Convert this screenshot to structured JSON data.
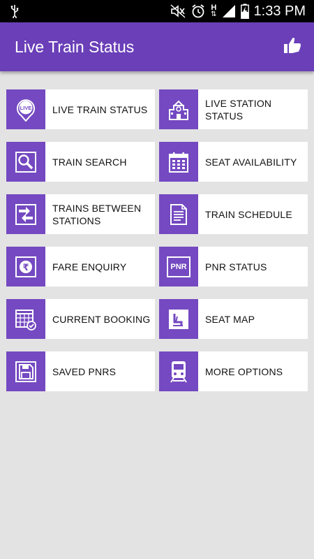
{
  "status_bar": {
    "time": "1:33 PM",
    "network_label": "H",
    "icons": [
      "usb-icon",
      "mute-icon",
      "alarm-icon",
      "network-data-icon",
      "signal-icon",
      "battery-charging-icon"
    ]
  },
  "app_bar": {
    "title": "Live Train Status",
    "action_icon": "thumbs-up-icon",
    "color": "#6a3fb8"
  },
  "menu": {
    "accent_color": "#7449c1",
    "items": [
      {
        "label": "LIVE TRAIN STATUS",
        "icon": "live-pin-icon"
      },
      {
        "label": "LIVE STATION STATUS",
        "icon": "station-building-icon"
      },
      {
        "label": "TRAIN SEARCH",
        "icon": "magnifier-icon"
      },
      {
        "label": "SEAT AVAILABILITY",
        "icon": "calendar-grid-icon"
      },
      {
        "label": "TRAINS BETWEEN STATIONS",
        "icon": "swap-arrows-icon"
      },
      {
        "label": "TRAIN SCHEDULE",
        "icon": "document-list-icon"
      },
      {
        "label": "FARE ENQUIRY",
        "icon": "rupee-coin-icon"
      },
      {
        "label": "PNR STATUS",
        "icon": "pnr-icon",
        "icon_text": "PNR"
      },
      {
        "label": "CURRENT BOOKING",
        "icon": "booking-calendar-icon"
      },
      {
        "label": "SEAT MAP",
        "icon": "seat-icon"
      },
      {
        "label": "SAVED PNRS",
        "icon": "floppy-disk-icon"
      },
      {
        "label": "MORE OPTIONS",
        "icon": "train-front-icon"
      }
    ]
  }
}
